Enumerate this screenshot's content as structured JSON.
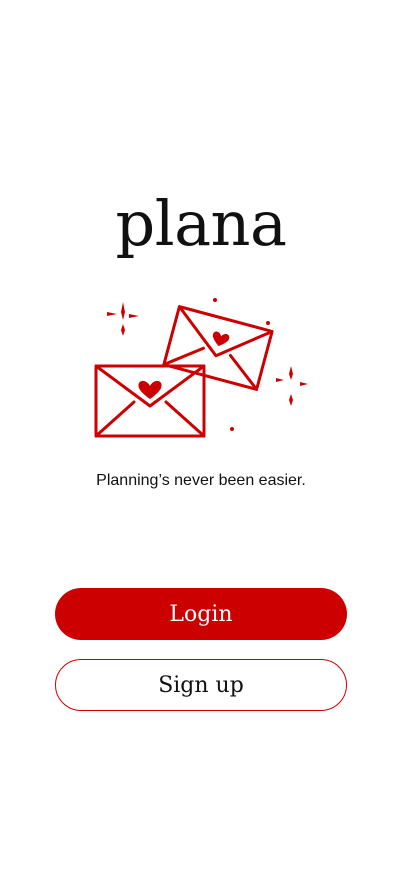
{
  "app": {
    "title": "plana",
    "tagline": "Planning’s never been easier."
  },
  "hero": {
    "icon": "envelopes-with-hearts-icon"
  },
  "actions": {
    "login_label": "Login",
    "signup_label": "Sign up"
  },
  "colors": {
    "accent": "#cc0000",
    "text": "#111111",
    "background": "#ffffff"
  }
}
